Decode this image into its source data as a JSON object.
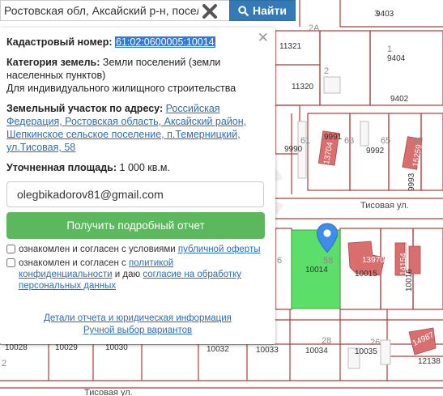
{
  "search": {
    "value": "Ростовская обл, Аксайский р-н, посел",
    "button_label": "Найти"
  },
  "panel": {
    "cadastral_label": "Кадастровый номер:",
    "cadastral_value": "61:02:0600005:10014",
    "category_label": "Категория земель:",
    "category_value": "Земли поселений (земли населенных пунктов)",
    "usage": "Для индивидуального жилищного строительства",
    "address_label": "Земельный участок по адресу:",
    "address_value": "Российская Федерация, Ростовская область, Аксайский район, Шепкинское сельское поселение, п.Темерницкий, ул.Тисовая, 58",
    "area_label": "Уточненная площадь:",
    "area_value": "1 000 кв.м.",
    "email_value": "olegbikadorov81@gmail.com",
    "report_button": "Получить подробный отчет",
    "consent1_text": "ознакомлен и согласен с условиями",
    "consent1_link": "публичной оферты",
    "consent2_text": "ознакомлен и согласен с",
    "consent2_link": "политикой конфиденциальности",
    "consent2_mid": "и даю",
    "consent2_link2": "согласие на обработку персональных данных",
    "details_link": "Детали отчета и юридическая информация",
    "manual_link": "Ручной выбор вариантов"
  },
  "map": {
    "street_top": "Тисовая ул.",
    "street_bottom": "Тисовая ул.",
    "parcel_numbers": [
      "9403",
      "3",
      "2А",
      "1",
      "9404",
      "11321",
      "2",
      "11320",
      "9402",
      "9991",
      "61",
      "63",
      "65",
      "67",
      "9990",
      "9992",
      "6",
      "58",
      "10014",
      "10015",
      "13970",
      "10016",
      "9993",
      "15259",
      "13704",
      "14154",
      "10029",
      "10030",
      "10032",
      "10033",
      "28",
      "10034",
      "10035",
      "26",
      "14987",
      "12138",
      "10028",
      "2"
    ]
  }
}
